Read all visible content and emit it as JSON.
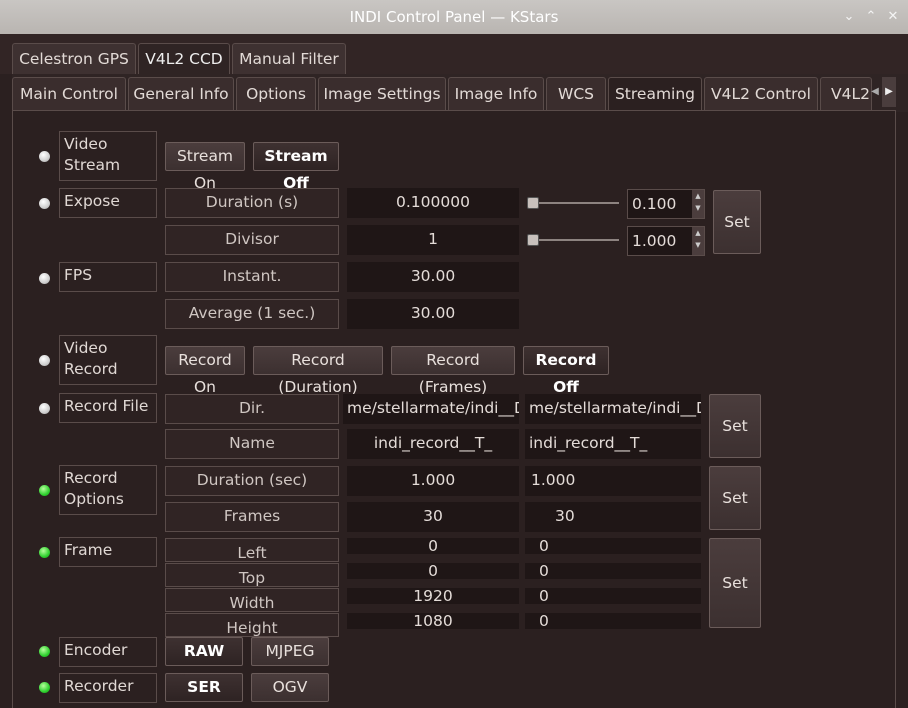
{
  "window": {
    "title": "INDI Control Panel — KStars"
  },
  "device_tabs": [
    "Celestron GPS",
    "V4L2 CCD",
    "Manual Filter"
  ],
  "sub_tabs": [
    "Main Control",
    "General Info",
    "Options",
    "Image Settings",
    "Image Info",
    "WCS",
    "Streaming",
    "V4L2 Control",
    "V4L2"
  ],
  "video_stream": {
    "name": "Video Stream",
    "on": "Stream On",
    "off": "Stream Off"
  },
  "expose": {
    "name": "Expose",
    "duration_label": "Duration (s)",
    "duration_value": "0.100000",
    "duration_spin": "0.100",
    "divisor_label": "Divisor",
    "divisor_value": "1",
    "divisor_spin": "1.000",
    "set": "Set"
  },
  "fps": {
    "name": "FPS",
    "instant_label": "Instant.",
    "instant_value": "30.00",
    "average_label": "Average (1 sec.)",
    "average_value": "30.00"
  },
  "video_record": {
    "name": "Video Record",
    "record_on": "Record On",
    "record_duration": "Record (Duration)",
    "record_frames": "Record (Frames)",
    "record_off": "Record Off"
  },
  "record_file": {
    "name": "Record File",
    "dir_label": "Dir.",
    "dir_value": "me/stellarmate/indi__D_",
    "dir_input": "me/stellarmate/indi__D_",
    "name_label": "Name",
    "name_value": "indi_record__T_",
    "name_input": "indi_record__T_",
    "set": "Set"
  },
  "record_options": {
    "name": "Record Options",
    "duration_label": "Duration (sec)",
    "duration_value": "1.000",
    "duration_input": "1.000",
    "frames_label": "Frames",
    "frames_value": "30",
    "frames_input": "30",
    "set": "Set"
  },
  "frame": {
    "name": "Frame",
    "left_label": "Left",
    "left_value": "0",
    "left_input": "0",
    "top_label": "Top",
    "top_value": "0",
    "top_input": "0",
    "width_label": "Width",
    "width_value": "1920",
    "width_input": "0",
    "height_label": "Height",
    "height_value": "1080",
    "height_input": "0",
    "set": "Set"
  },
  "encoder": {
    "name": "Encoder",
    "raw": "RAW",
    "mjpeg": "MJPEG"
  },
  "recorder": {
    "name": "Recorder",
    "ser": "SER",
    "ogv": "OGV"
  }
}
